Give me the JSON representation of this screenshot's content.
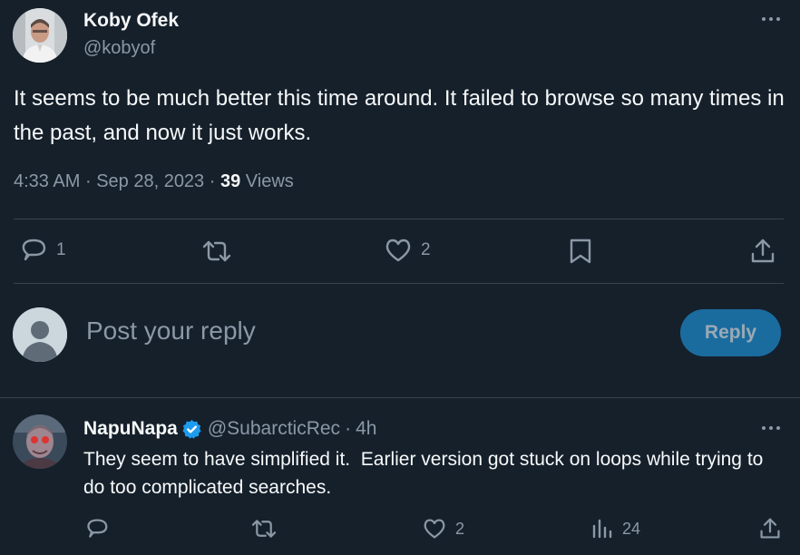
{
  "tweet": {
    "author_name": "Koby Ofek",
    "author_handle": "@kobyof",
    "text": "It seems to be much better this time around. It failed to browse so many times in the past, and now it just works.",
    "time": "4:33 AM",
    "sep1": "·",
    "date": "Sep 28, 2023",
    "sep2": "·",
    "views_count": "39",
    "views_label": "Views",
    "actions": {
      "reply_count": "1",
      "like_count": "2"
    }
  },
  "composer": {
    "placeholder": "Post your reply",
    "button_label": "Reply"
  },
  "reply": {
    "author_name": "NapuNapa",
    "author_handle": "@SubarcticRec",
    "sep": "·",
    "time": "4h",
    "text": "They seem to have simplified it.  Earlier version got stuck on loops while trying to do too complicated searches.",
    "actions": {
      "like_count": "2",
      "views_count": "24"
    }
  },
  "colors": {
    "background": "#15202b",
    "muted": "#8b98a5",
    "accent": "#1d9bf0",
    "verified": "#1d9bf0",
    "reply_button_bg": "#1a6c9f"
  }
}
